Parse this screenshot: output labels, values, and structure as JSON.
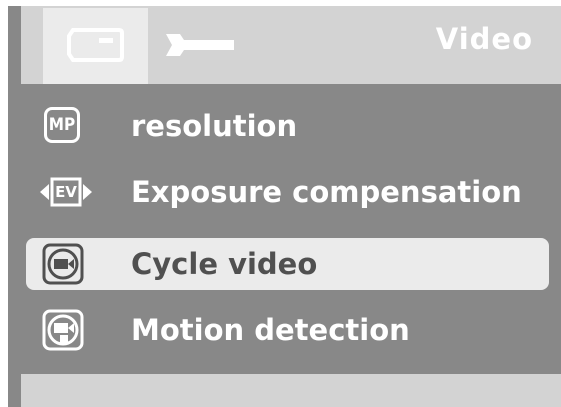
{
  "header": {
    "title": "Video",
    "tabs": [
      {
        "name": "video-camera-tab",
        "icon": "video-camera-icon",
        "active": true
      },
      {
        "name": "settings-tab",
        "icon": "wrench-icon",
        "active": false
      }
    ]
  },
  "menu": {
    "items": [
      {
        "label": "resolution",
        "icon": "mp-icon",
        "icon_text": "MP",
        "selected": false
      },
      {
        "label": "Exposure compensation",
        "icon": "ev-icon",
        "icon_text": "EV",
        "selected": false
      },
      {
        "label": "Cycle video",
        "icon": "cycle-video-icon",
        "selected": true
      },
      {
        "label": "Motion detection",
        "icon": "motion-detection-icon",
        "selected": false
      }
    ]
  },
  "colors": {
    "background": "#888888",
    "header": "#d3d3d3",
    "highlight": "#ebebeb",
    "text": "#ffffff",
    "selected_text": "#505050"
  }
}
